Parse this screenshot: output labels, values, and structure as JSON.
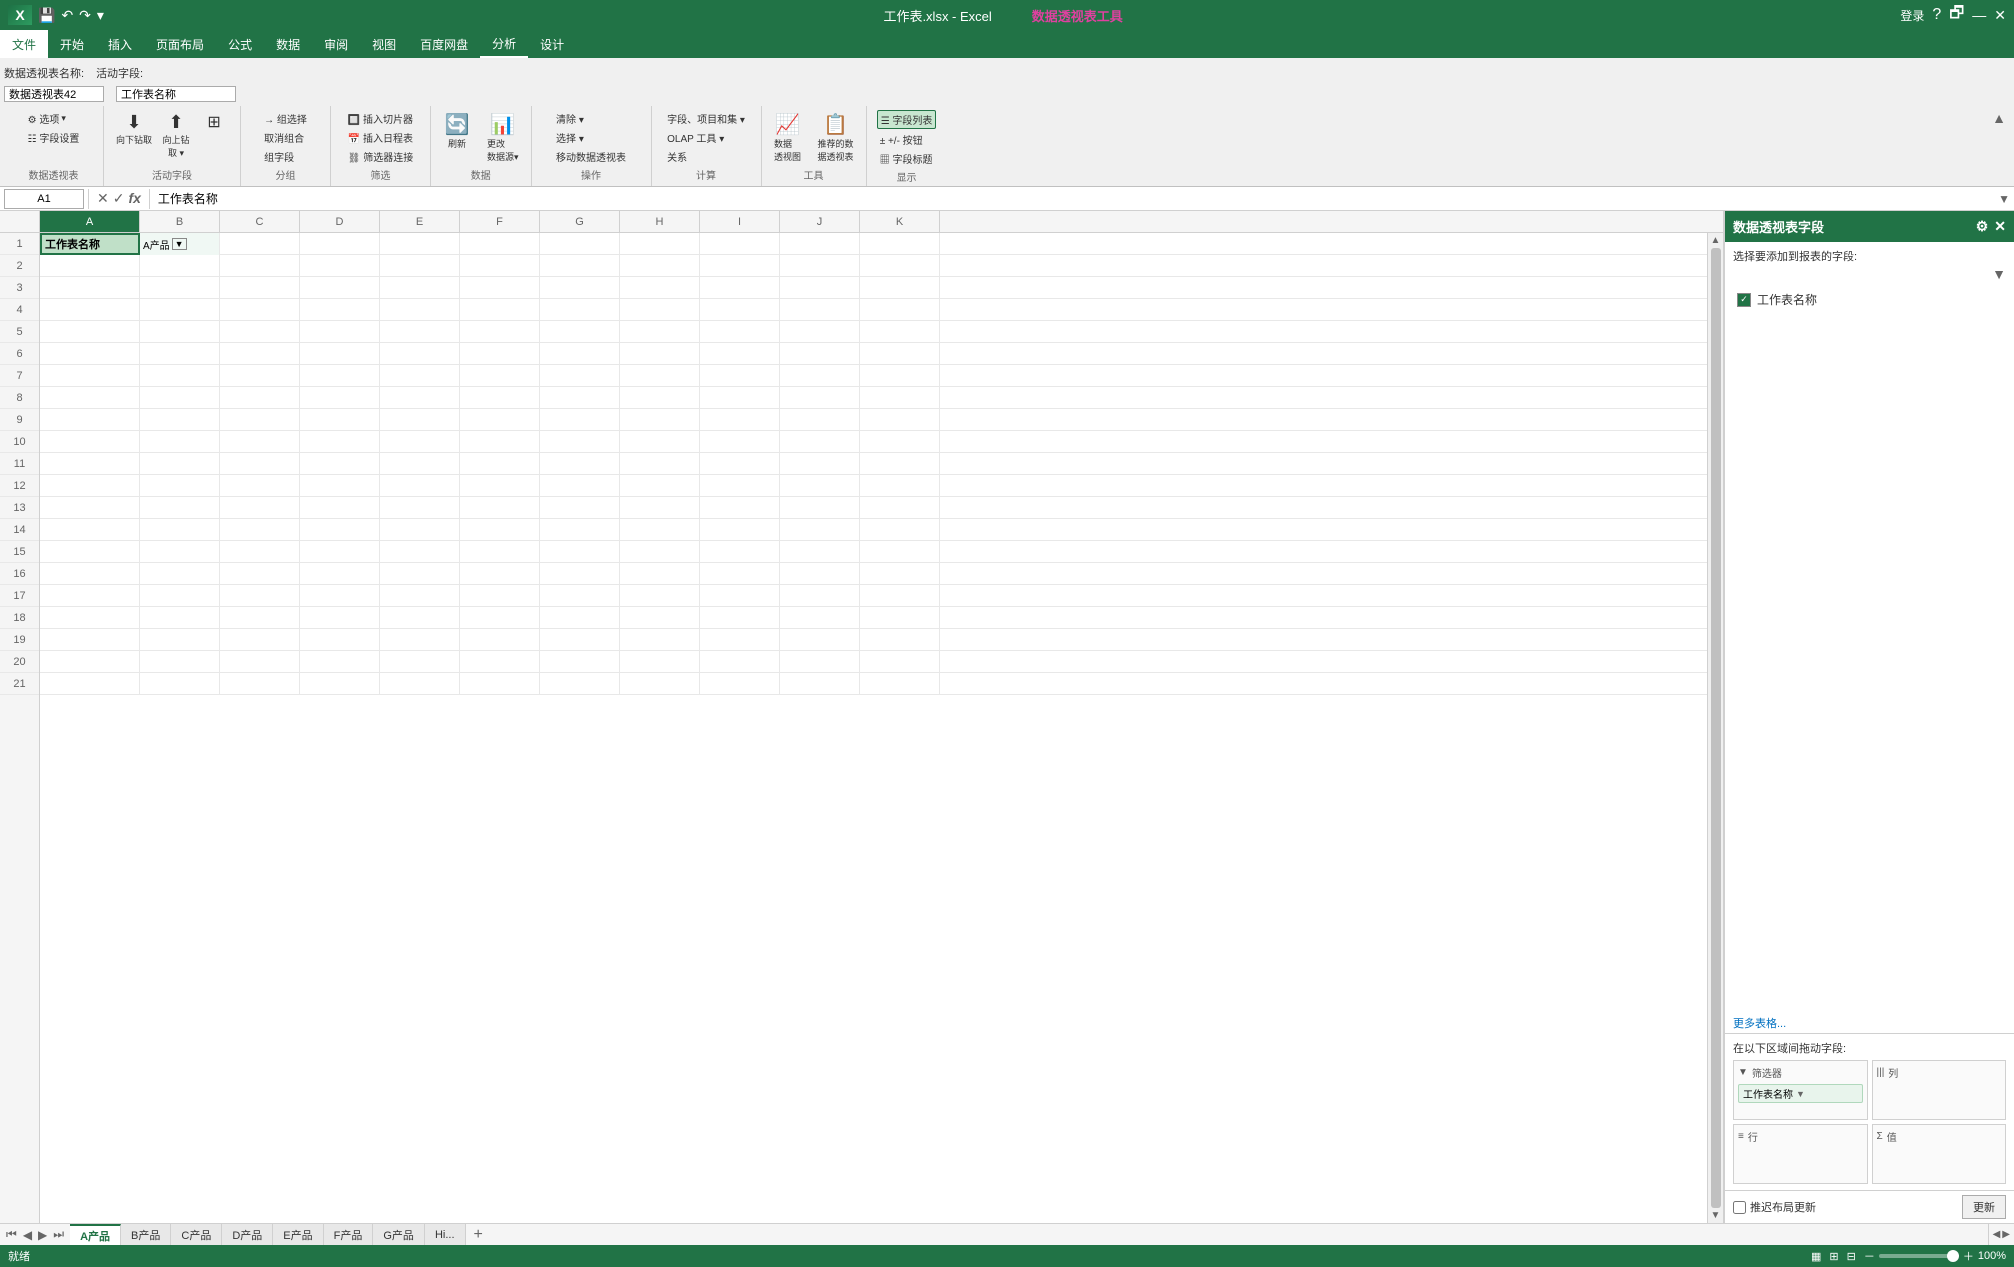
{
  "titleBar": {
    "appTitle": "工作表.xlsx - Excel",
    "pivotTools": "数据透视表工具",
    "loginBtn": "登录",
    "helpBtn": "?",
    "restoreBtn": "🗗",
    "minimizeBtn": "—",
    "closeBtn": "✕"
  },
  "menuBar": {
    "items": [
      "文件",
      "开始",
      "插入",
      "页面布局",
      "公式",
      "数据",
      "审阅",
      "视图",
      "百度网盘",
      "分析",
      "设计"
    ]
  },
  "ribbon": {
    "pivotNameLabel": "数据透视表名称:",
    "activeFieldLabel": "活动字段:",
    "pivotName": "数据透视表42",
    "activeField": "工作表名称",
    "groups": [
      {
        "name": "数据透视表",
        "items": [
          "选项 ▼",
          "字段设置"
        ]
      },
      {
        "name": "活动字段",
        "items": [
          "向下钻取",
          "向上钻取▼"
        ]
      },
      {
        "name": "分组",
        "items": [
          "→ 组选择",
          "取消组合",
          "组字段"
        ]
      },
      {
        "name": "筛选",
        "items": [
          "插入切片器",
          "插入日程表",
          "筛选器连接"
        ]
      },
      {
        "name": "数据",
        "items": [
          "刷新",
          "更改数据源▼"
        ]
      },
      {
        "name": "操作",
        "items": [
          "清除▼",
          "选择▼",
          "移动数据透视表"
        ]
      },
      {
        "name": "计算",
        "items": [
          "字段、项目和集▼",
          "OLAP工具▼",
          "关系"
        ]
      },
      {
        "name": "工具",
        "items": [
          "数据透视图",
          "推荐的数据透视表"
        ]
      },
      {
        "name": "显示",
        "items": [
          "字段列表",
          "+/- 按钮",
          "字段标题"
        ]
      }
    ]
  },
  "formulaBar": {
    "cellRef": "A1",
    "formula": "工作表名称"
  },
  "spreadsheet": {
    "columns": [
      "A",
      "B",
      "C",
      "D",
      "E",
      "F",
      "G",
      "H",
      "I",
      "J",
      "K"
    ],
    "rows": [
      1,
      2,
      3,
      4,
      5,
      6,
      7,
      8,
      9,
      10,
      11,
      12,
      13,
      14,
      15,
      16,
      17,
      18,
      19,
      20,
      21
    ],
    "cellA1": "工作表名称",
    "cellB1Label": "A产品",
    "cellB1HasFilter": true
  },
  "pivotPanel": {
    "title": "数据透视表字段",
    "sectionLabel": "选择要添加到报表的字段:",
    "fields": [
      {
        "label": "工作表名称",
        "checked": true
      },
      {
        "label": "更多表格...",
        "isLink": true
      }
    ],
    "dragLabel": "在以下区域间拖动字段:",
    "areas": {
      "filter": {
        "icon": "▼",
        "label": "筛选器",
        "chips": [
          "工作表名称"
        ]
      },
      "columns": {
        "icon": "|||",
        "label": "列",
        "chips": []
      },
      "rows": {
        "icon": "≡",
        "label": "行",
        "chips": []
      },
      "values": {
        "icon": "Σ",
        "label": "值",
        "chips": []
      }
    },
    "deferLabel": "推迟布局更新",
    "updateBtn": "更新"
  },
  "sheetTabs": {
    "tabs": [
      "A产品",
      "B产品",
      "C产品",
      "D产品",
      "E产品",
      "F产品",
      "G产品",
      "Hi..."
    ],
    "activeTab": "A产品"
  },
  "statusBar": {
    "status": "就绪",
    "zoomLevel": "100%"
  }
}
